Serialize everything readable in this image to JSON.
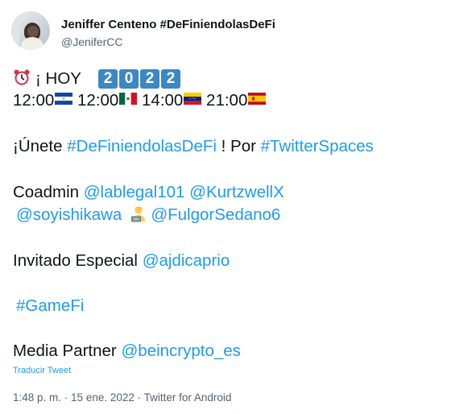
{
  "author": {
    "name": "Jeniffer Centeno #DeFiniendolasDeFi",
    "handle": "@JeniferCC"
  },
  "tweet": {
    "line1": {
      "prefix": "¡ HOY",
      "year_digits": [
        "2",
        "0",
        "2",
        "2"
      ]
    },
    "times": [
      "12:00",
      "12:00",
      "14:00",
      "21:00"
    ],
    "join_prefix": "¡Únete ",
    "join_hashtag": "#DeFiniendolasDeFi",
    "join_middle": " ! Por ",
    "join_hashtag2": "#TwitterSpaces",
    "coadmin_label": "Coadmin ",
    "coadmins": [
      "@lablegal101",
      "@KurtzwellX",
      "@soyishikawa",
      "@FulgorSedano6"
    ],
    "guest_label": "Invitado Especial ",
    "guest": "@ajdicaprio",
    "hashtag_gamefi": "#GameFi",
    "partner_label": "Media Partner ",
    "partner": "@beincrypto_es"
  },
  "translate_label": "Traducir Tweet",
  "meta": {
    "time": "1:48 p. m.",
    "separator": " · ",
    "date": "15 ene. 2022",
    "source": "Twitter for Android"
  },
  "colors": {
    "link": "#1d9bf0",
    "text": "#0f1419",
    "muted": "#536471",
    "keycap": "#3b88c3"
  },
  "icons": [
    "alarm-clock-icon",
    "flag-el-salvador-icon",
    "flag-mexico-icon",
    "flag-venezuela-icon",
    "flag-spain-icon",
    "technologist-icon"
  ]
}
